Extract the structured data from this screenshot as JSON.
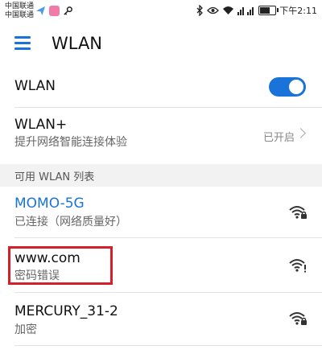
{
  "status_bar": {
    "carrier_1": "中国联通",
    "carrier_2": "中国联通",
    "time": "下午2:11",
    "battery_level": 0.75
  },
  "header": {
    "title": "WLAN",
    "menu_icon": "hamburger-menu-icon"
  },
  "wlan_toggle": {
    "label": "WLAN",
    "enabled": true
  },
  "wlan_plus": {
    "title": "WLAN+",
    "subtitle": "提升网络智能连接体验",
    "status": "已开启"
  },
  "available_header": "可用 WLAN 列表",
  "networks": [
    {
      "name": "MOMO-5G",
      "status": "已连接（网络质量好）",
      "connected": true,
      "icon": "wifi-locked-icon"
    },
    {
      "name": "www.com",
      "status": "密码错误",
      "connected": false,
      "icon": "wifi-warning-icon"
    },
    {
      "name": "MERCURY_31-2",
      "status": "加密",
      "connected": false,
      "icon": "wifi-locked-icon"
    }
  ],
  "colors": {
    "accent": "#1a73d9",
    "connected_text": "#1a73d9",
    "highlight": "#d3202a"
  }
}
